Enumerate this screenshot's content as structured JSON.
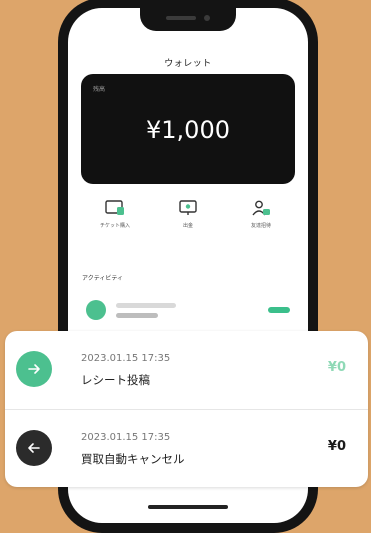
{
  "wallet": {
    "title": "ウォレット",
    "card_label": "残高",
    "balance": "¥1,000"
  },
  "actions": [
    {
      "label": "チケット購入",
      "icon": "ticket-icon"
    },
    {
      "label": "出金",
      "icon": "withdraw-icon"
    },
    {
      "label": "友達招待",
      "icon": "invite-friend-icon"
    }
  ],
  "activity": {
    "section_title": "アクティビティ"
  },
  "transactions": [
    {
      "date": "2023.01.15 17:35",
      "title": "レシート投稿",
      "amount": "¥0",
      "icon": "arrow-right-icon",
      "icon_color": "#4cc08f",
      "amount_color": "#8fd9b6"
    },
    {
      "date": "2023.01.15 17:35",
      "title": "買取自動キャンセル",
      "amount": "¥0",
      "icon": "arrow-left-icon",
      "icon_color": "#2b2b2b",
      "amount_color": "#1a1a1a"
    }
  ],
  "colors": {
    "background": "#dda56a",
    "accent": "#4cc08f",
    "card": "#111111"
  }
}
